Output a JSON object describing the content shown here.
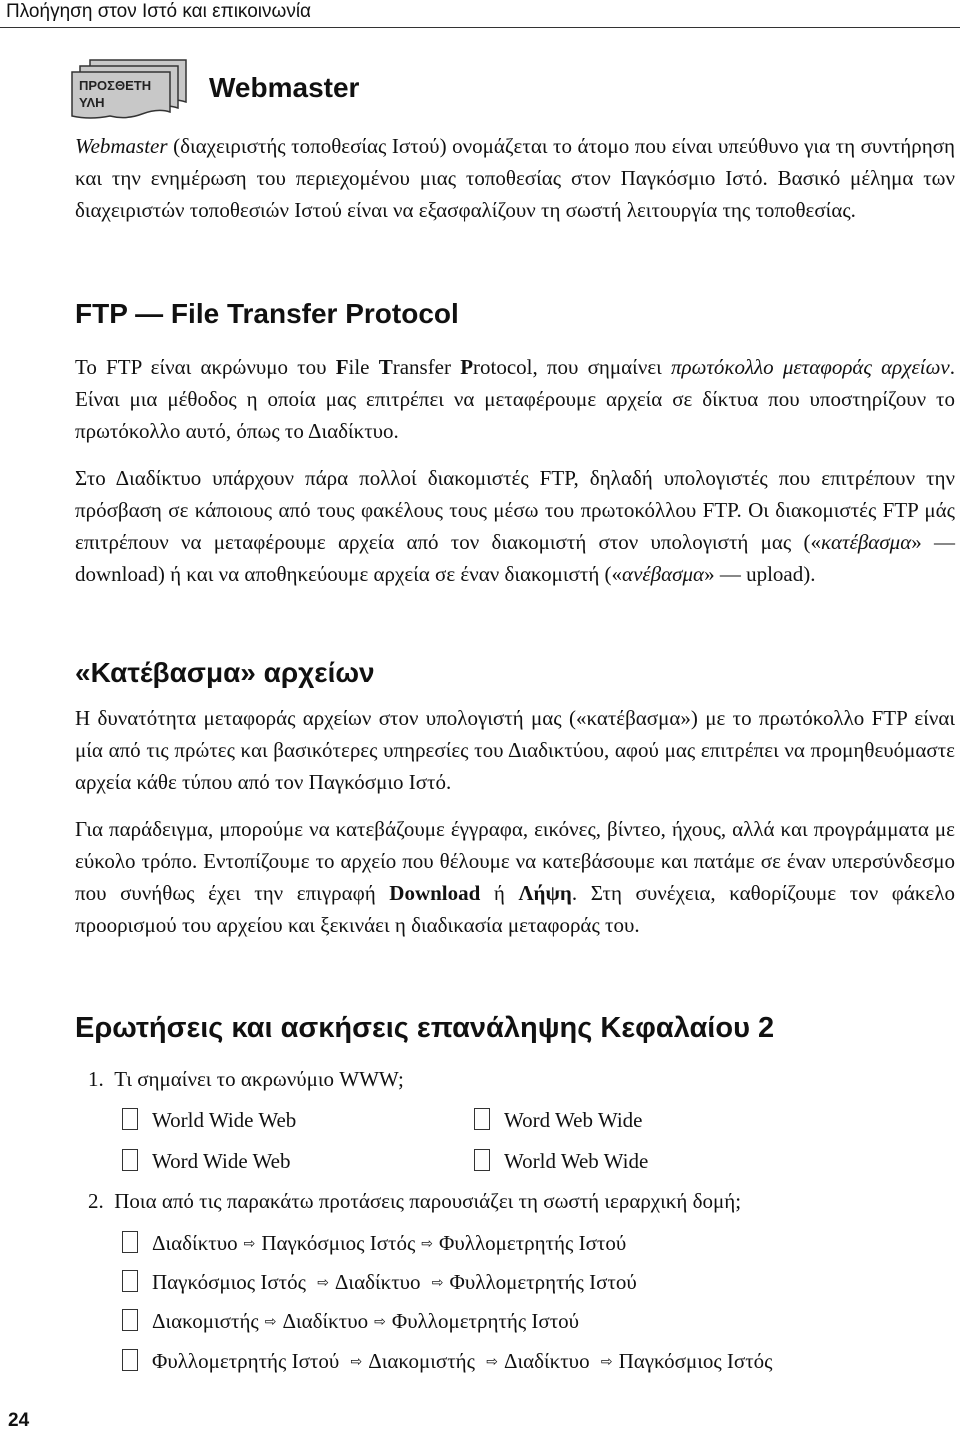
{
  "header": {
    "title": "Πλοήγηση στον Ιστό και επικοινωνία"
  },
  "badge": {
    "line1": "ΠΡΟΣΘΕΤΗ",
    "line2": "ΥΛΗ"
  },
  "webmaster": {
    "title": "Webmaster",
    "term": "Webmaster",
    "text": " (διαχειριστής τοποθεσίας Ιστού) ονομάζεται το άτομο που είναι υπεύθυνο για τη συντήρηση και την ενημέρωση του περιεχομένου μιας τοποθεσίας στον Παγκόσμιο Ιστό. Βασικό μέλημα των διαχειριστών τοποθεσιών Ιστού είναι να εξασφαλίζουν τη σωστή λειτουργία της τοποθεσίας."
  },
  "ftp": {
    "title": "FTP — File Transfer Protocol",
    "p1_a": "Το FTP είναι ακρώνυμο του ",
    "p1_F": "F",
    "p1_ile": "ile ",
    "p1_T": "T",
    "p1_ransfer": "ransfer ",
    "p1_P": "P",
    "p1_rotocol": "rotocol, που σημαίνει ",
    "p1_em": "πρωτόκολλο μεταφοράς αρχείων",
    "p1_b": ". Είναι μια μέθοδος η οποία μας επιτρέπει να μεταφέρουμε αρχεία σε δίκτυα που υποστηρίζουν το πρωτόκολλο αυτό, όπως το Διαδίκτυο.",
    "p2_a": "Στο Διαδίκτυο υπάρχουν πάρα πολλοί διακομιστές FTP, δηλαδή υπολογιστές που επιτρέπουν την πρόσβαση σε κάποιους από τους φακέλους τους μέσω του πρωτοκόλλου FTP. Οι διακομιστές FTP μάς επιτρέπουν να μεταφέρουμε αρχεία από τον διακομιστή στον υπολογιστή μας («",
    "p2_em1": "κατέβασμα",
    "p2_b": "» — download) ή και να αποθηκεύουμε αρχεία σε έναν διακομιστή («",
    "p2_em2": "ανέβασμα",
    "p2_c": "» — upload)."
  },
  "download": {
    "title": "«Κατέβασμα» αρχείων",
    "p1": "Η δυνατότητα μεταφοράς αρχείων στον υπολογιστή μας («κατέβασμα») με το πρωτόκολλο FTP είναι μία από τις πρώτες και βασικότερες υπηρεσίες του Διαδικτύου, αφού μας επιτρέπει να προμηθευόμαστε αρχεία κάθε τύπου από τον Παγκόσμιο Ιστό.",
    "p2_a": "Για παράδειγμα, μπορούμε να κατεβάζουμε έγγραφα, εικόνες, βίντεο, ήχους, αλλά και προγράμματα με εύκολο τρόπο. Εντοπίζουμε το αρχείο που θέλουμε να κατεβάσουμε και πατάμε σε έναν υπερσύνδεσμο που συνήθως έχει την επιγραφή ",
    "p2_bold1": "Download",
    "p2_mid": " ή ",
    "p2_bold2": "Λήψη",
    "p2_b": ". Στη συνέχεια, καθορίζουμε τον φάκελο προορισμού του αρχείου και ξεκινάει η διαδικασία μεταφοράς του."
  },
  "questions": {
    "title": "Ερωτήσεις και ασκήσεις επανάληψης Κεφαλαίου 2",
    "q1": {
      "number": "1.",
      "text": "Τι σημαίνει το ακρωνύμιο WWW;",
      "options": [
        "World Wide Web",
        "Word Web Wide",
        "Word Wide Web",
        "World Web Wide"
      ]
    },
    "q2": {
      "number": "2.",
      "text": "Ποια από τις παρακάτω προτάσεις παρουσιάζει τη σωστή ιεραρχική δομή;",
      "options": [
        [
          "Διαδίκτυο",
          "Παγκόσμιος Ιστός",
          "Φυλλομετρητής Ιστού"
        ],
        [
          "Παγκόσμιος Ιστός",
          "Διαδίκτυο",
          "Φυλλομετρητής Ιστού"
        ],
        [
          "Διακομιστής",
          "Διαδίκτυο",
          "Φυλλομετρητής Ιστού"
        ],
        [
          "Φυλλομετρητής Ιστού",
          "Διακομιστής",
          "Διαδίκτυο",
          "Παγκόσμιος Ιστός"
        ]
      ],
      "arrow_icon": "⇨"
    }
  },
  "page_number": "24"
}
